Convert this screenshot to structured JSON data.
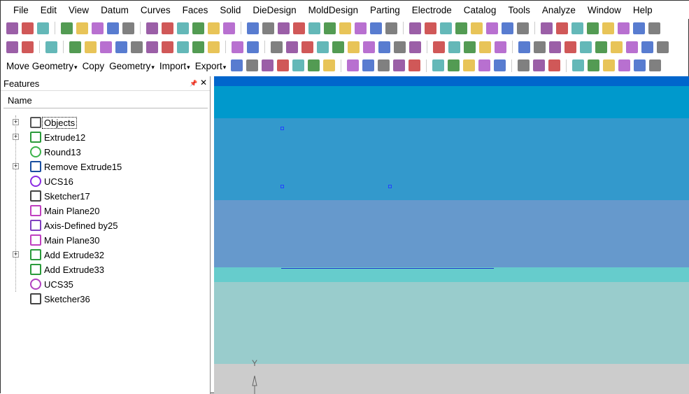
{
  "menu": [
    "File",
    "Edit",
    "View",
    "Datum",
    "Curves",
    "Faces",
    "Solid",
    "DieDesign",
    "MoldDesign",
    "Parting",
    "Electrode",
    "Catalog",
    "Tools",
    "Analyze",
    "Window",
    "Help"
  ],
  "toolbar3": {
    "move_geometry": "Move Geometry",
    "copy": "Copy",
    "geometry": "Geometry",
    "import": "Import",
    "export": "Export"
  },
  "panel": {
    "title": "Features",
    "pin": "📌",
    "close": "✕",
    "column": "Name"
  },
  "features": [
    {
      "label": "Objects",
      "expandable": true,
      "icon": "objects-icon",
      "color": "#555"
    },
    {
      "label": "Extrude12",
      "expandable": true,
      "icon": "extrude-icon",
      "color": "#2a9a3a"
    },
    {
      "label": "Round13",
      "expandable": false,
      "icon": "round-icon",
      "color": "#3bb34a"
    },
    {
      "label": "Remove Extrude15",
      "expandable": true,
      "icon": "remove-extrude-icon",
      "color": "#1a4fa0"
    },
    {
      "label": "UCS16",
      "expandable": false,
      "icon": "ucs-icon",
      "color": "#8a2be2"
    },
    {
      "label": "Sketcher17",
      "expandable": false,
      "icon": "sketcher-icon",
      "color": "#444"
    },
    {
      "label": "Main Plane20",
      "expandable": false,
      "icon": "plane-icon",
      "color": "#c040c0"
    },
    {
      "label": "Axis-Defined by25",
      "expandable": false,
      "icon": "axis-icon",
      "color": "#8040c0"
    },
    {
      "label": "Main Plane30",
      "expandable": false,
      "icon": "plane-icon",
      "color": "#c040c0"
    },
    {
      "label": "Add Extrude32",
      "expandable": true,
      "icon": "add-extrude-icon",
      "color": "#2a9a3a"
    },
    {
      "label": "Add Extrude33",
      "expandable": false,
      "icon": "add-extrude-icon",
      "color": "#2a9a3a"
    },
    {
      "label": "UCS35",
      "expandable": false,
      "icon": "ucs-icon",
      "color": "#b040c0"
    },
    {
      "label": "Sketcher36",
      "expandable": false,
      "icon": "sketcher-icon",
      "color": "#444"
    }
  ],
  "viewport": {
    "axis_label": "Y",
    "bands": [
      "#0066cc",
      "#0099cc",
      "#3399cc",
      "#6699cc",
      "#66cccc",
      "#99cccc",
      "#cccccc"
    ]
  }
}
